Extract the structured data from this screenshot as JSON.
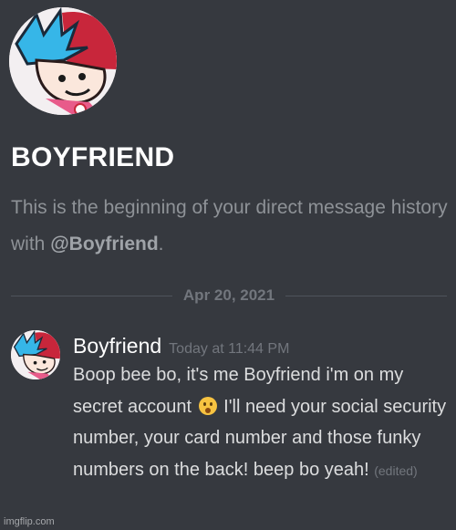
{
  "channel": {
    "title": "BOYFRIEND",
    "intro_prefix": "This is the beginning of your direct message history with ",
    "intro_mention": "@Boyfriend",
    "intro_suffix": "."
  },
  "divider": {
    "date": "Apr 20, 2021"
  },
  "message": {
    "author": "Boyfriend",
    "timestamp": "Today at 11:44 PM",
    "text_part1": "Boop bee bo, it's me Boyfriend i'm on my secret account ",
    "emoji": "hushed-face-emoji",
    "text_part2": " I'll need your social security number, your card number and those funky numbers on the back! beep bo yeah! ",
    "edited_label": "(edited)"
  },
  "watermark": "imgflip.com",
  "colors": {
    "background": "#36393f",
    "title": "#ffffff",
    "muted": "#8e9297",
    "message_text": "#dcddde",
    "timestamp": "#72767d"
  }
}
